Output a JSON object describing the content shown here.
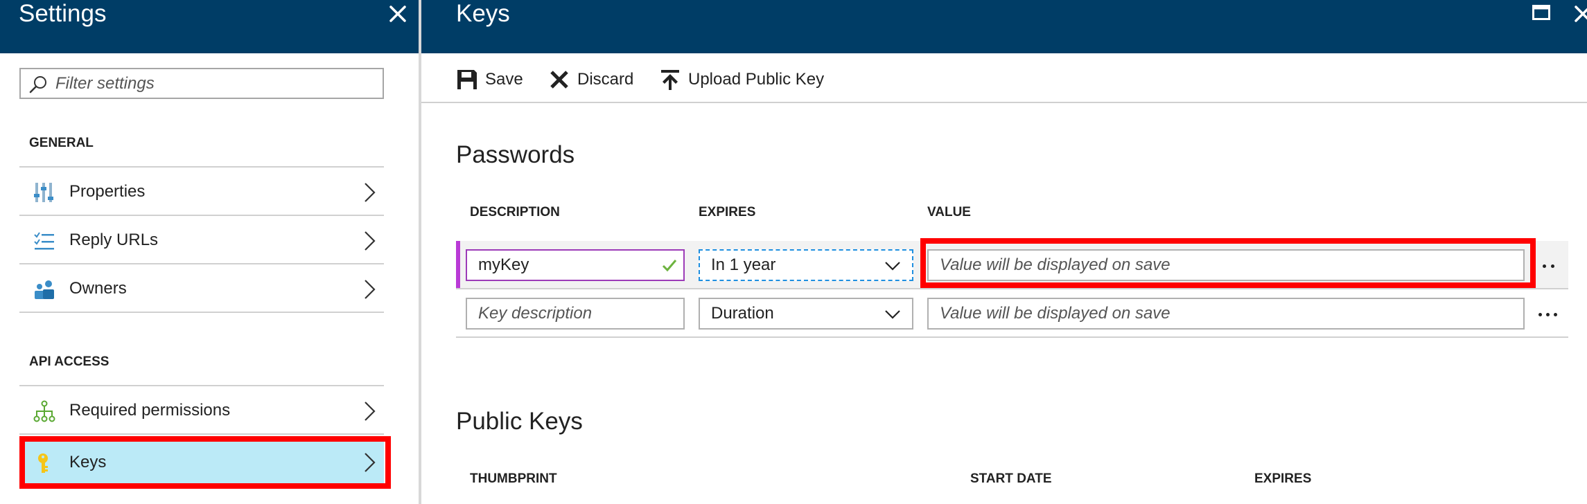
{
  "settings_blade": {
    "title": "Settings",
    "filter_placeholder": "Filter settings",
    "sections": {
      "general": "GENERAL",
      "api_access": "API ACCESS"
    },
    "items": [
      {
        "label": "Properties",
        "icon": "sliders-icon"
      },
      {
        "label": "Reply URLs",
        "icon": "list-icon"
      },
      {
        "label": "Owners",
        "icon": "users-icon"
      },
      {
        "label": "Required permissions",
        "icon": "hierarchy-icon"
      },
      {
        "label": "Keys",
        "icon": "key-icon",
        "selected": true
      }
    ]
  },
  "keys_blade": {
    "title": "Keys",
    "toolbar": {
      "save_label": "Save",
      "discard_label": "Discard",
      "upload_label": "Upload Public Key"
    },
    "passwords": {
      "heading": "Passwords",
      "columns": [
        "DESCRIPTION",
        "EXPIRES",
        "VALUE"
      ],
      "rows": [
        {
          "description": "myKey",
          "description_placeholder": "Key description",
          "expires": "In 1 year",
          "value_placeholder": "Value will be displayed on save"
        },
        {
          "description": "",
          "description_placeholder": "Key description",
          "expires": "Duration",
          "value_placeholder": "Value will be displayed on save"
        }
      ]
    },
    "public_keys": {
      "heading": "Public Keys",
      "columns": [
        "THUMBPRINT",
        "START DATE",
        "EXPIRES"
      ]
    }
  },
  "colors": {
    "header_bg": "#003d66",
    "selected_bg": "#bbeaf7",
    "highlight_red": "#ff0000",
    "accent_purple": "#b93ad6",
    "focus_blue": "#1e8fe0",
    "valid_green": "#6db33f"
  }
}
